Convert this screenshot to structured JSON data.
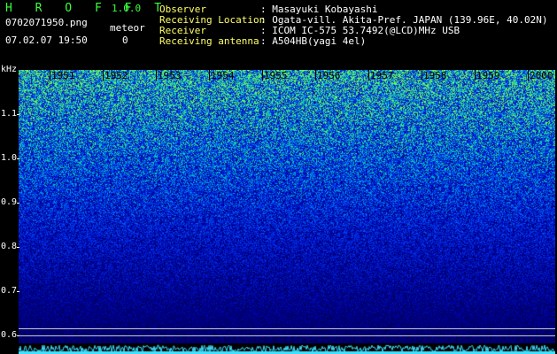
{
  "header": {
    "app_letters": "H R O F F T",
    "version": "1.0.0",
    "filename": "0702071950.png",
    "datetime": "07.02.07 19:50",
    "meteor_label": "meteor",
    "meteor_count": "0"
  },
  "meta": [
    {
      "label": "Observer",
      "value": ": Masayuki Kobayashi"
    },
    {
      "label": "Receiving Location",
      "value": ": Ogata-vill. Akita-Pref. JAPAN (139.96E, 40.02N)"
    },
    {
      "label": "Receiver",
      "value": ": ICOM IC-575 53.7492(@LCD)MHz USB"
    },
    {
      "label": "Receiving antenna",
      "value": ": A504HB(yagi 4el)"
    }
  ],
  "axis": {
    "y_unit": "kHz",
    "y_ticks": [
      "1.1",
      "1.0",
      "0.9",
      "0.8",
      "0.7",
      "0.6"
    ],
    "x_ticks": [
      "1951",
      "1952",
      "1953",
      "1954",
      "1955",
      "1956",
      "1957",
      "1958",
      "1959",
      "2000"
    ]
  },
  "colors": {
    "background": "#000000",
    "title_green": "#3cff3c",
    "label_yellow": "#ffff66",
    "noise_dark": "#0a0a7a",
    "noise_mid": "#1a3cff",
    "noise_bright": "#20e0c0",
    "spectrum_line": "#40e0ff"
  }
}
